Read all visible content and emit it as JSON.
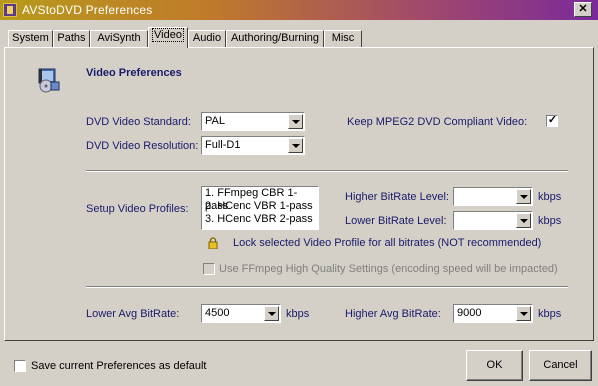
{
  "window": {
    "title": "AVStoDVD Preferences"
  },
  "tabs": [
    {
      "label": "System"
    },
    {
      "label": "Paths"
    },
    {
      "label": "AviSynth"
    },
    {
      "label": "Video"
    },
    {
      "label": "Audio"
    },
    {
      "label": "Authoring/Burning"
    },
    {
      "label": "Misc"
    }
  ],
  "video": {
    "heading": "Video Preferences",
    "standard_label": "DVD Video Standard:",
    "standard_value": "PAL",
    "resolution_label": "DVD Video Resolution:",
    "resolution_value": "Full-D1",
    "keep_mpeg2_label": "Keep MPEG2 DVD Compliant Video:",
    "keep_mpeg2_checked": true,
    "profiles_label": "Setup Video Profiles:",
    "profiles": [
      "1. FFmpeg CBR 1-pass",
      "2. HCenc VBR 1-pass",
      "3. HCenc VBR 2-pass"
    ],
    "higher_level_label": "Higher BitRate Level:",
    "higher_level_value": "",
    "lower_level_label": "Lower BitRate Level:",
    "lower_level_value": "",
    "kbps": "kbps",
    "lock_label": "Lock selected Video Profile for all bitrates (NOT recommended)",
    "ffmpeg_hq_label": "Use FFmpeg High Quality Settings (encoding speed will be impacted)",
    "lower_avg_label": "Lower Avg BitRate:",
    "lower_avg_value": "4500",
    "higher_avg_label": "Higher Avg BitRate:",
    "higher_avg_value": "9000"
  },
  "footer": {
    "save_default_label": "Save current Preferences as default",
    "ok_label": "OK",
    "cancel_label": "Cancel"
  }
}
